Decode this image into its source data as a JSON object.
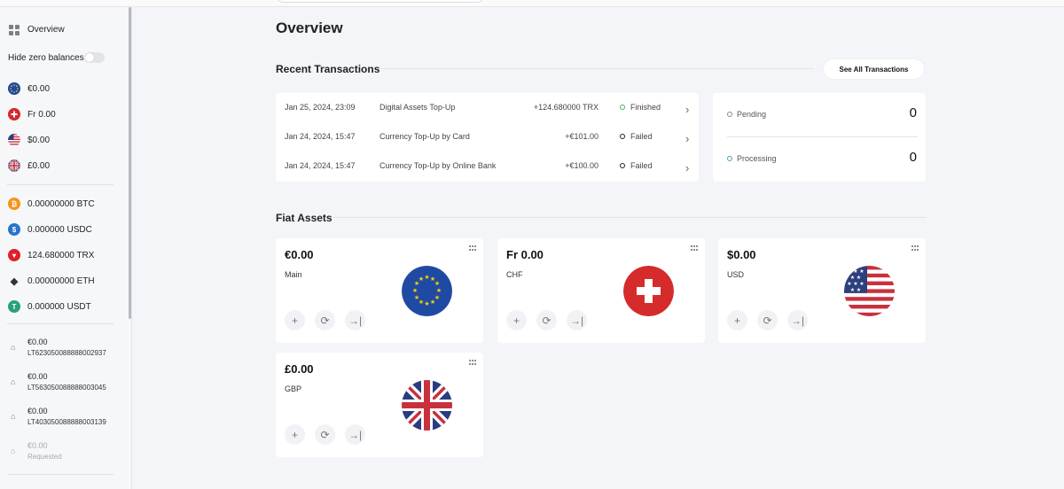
{
  "sidebar": {
    "overview_label": "Overview",
    "hide_zero_label": "Hide zero balances",
    "fiat": [
      {
        "label": "€0.00",
        "icon": "eu-flag-icon"
      },
      {
        "label": "Fr 0.00",
        "icon": "swiss-flag-icon"
      },
      {
        "label": "$0.00",
        "icon": "us-flag-icon"
      },
      {
        "label": "£0.00",
        "icon": "uk-flag-icon"
      }
    ],
    "crypto": [
      {
        "label": "0.00000000 BTC",
        "icon": "btc-icon",
        "color": "#f7931a"
      },
      {
        "label": "0.000000 USDC",
        "icon": "usdc-icon",
        "color": "#2775ca"
      },
      {
        "label": "124.680000 TRX",
        "icon": "trx-icon",
        "color": "#e0202a"
      },
      {
        "label": "0.00000000 ETH",
        "icon": "eth-icon",
        "color": "#333333"
      },
      {
        "label": "0.000000 USDT",
        "icon": "usdt-icon",
        "color": "#26a17b"
      }
    ],
    "accounts": [
      {
        "amount": "€0.00",
        "iban": "LT623050088888002937"
      },
      {
        "amount": "€0.00",
        "iban": "LT563050088888003045"
      },
      {
        "amount": "€0.00",
        "iban": "LT403050088888003139"
      },
      {
        "amount": "€0.00",
        "iban": "Requested"
      }
    ]
  },
  "main": {
    "title": "Overview",
    "recent": {
      "title": "Recent Transactions",
      "see_all": "See All Transactions",
      "rows": [
        {
          "date": "Jan 25, 2024, 23:09",
          "desc": "Digital Assets Top-Up",
          "amount": "+124.680000 TRX",
          "status": "Finished",
          "status_color": "#3cb85c"
        },
        {
          "date": "Jan 24, 2024, 15:47",
          "desc": "Currency Top-Up by Card",
          "amount": "+€101.00",
          "status": "Failed",
          "status_color": "#222222"
        },
        {
          "date": "Jan 24, 2024, 15:47",
          "desc": "Currency Top-Up by Online Bank",
          "amount": "+€100.00",
          "status": "Failed",
          "status_color": "#222222"
        }
      ]
    },
    "stats": [
      {
        "label": "Pending",
        "value": "0",
        "color": "#888888"
      },
      {
        "label": "Processing",
        "value": "0",
        "color": "#4fa3a8"
      }
    ],
    "fiat_title": "Fiat Assets",
    "fiat_assets": [
      {
        "amount": "€0.00",
        "label": "Main",
        "flag": "eu-flag-icon"
      },
      {
        "amount": "Fr 0.00",
        "label": "CHF",
        "flag": "swiss-flag-icon"
      },
      {
        "amount": "$0.00",
        "label": "USD",
        "flag": "us-flag-icon"
      },
      {
        "amount": "£0.00",
        "label": "GBP",
        "flag": "uk-flag-icon"
      }
    ]
  }
}
